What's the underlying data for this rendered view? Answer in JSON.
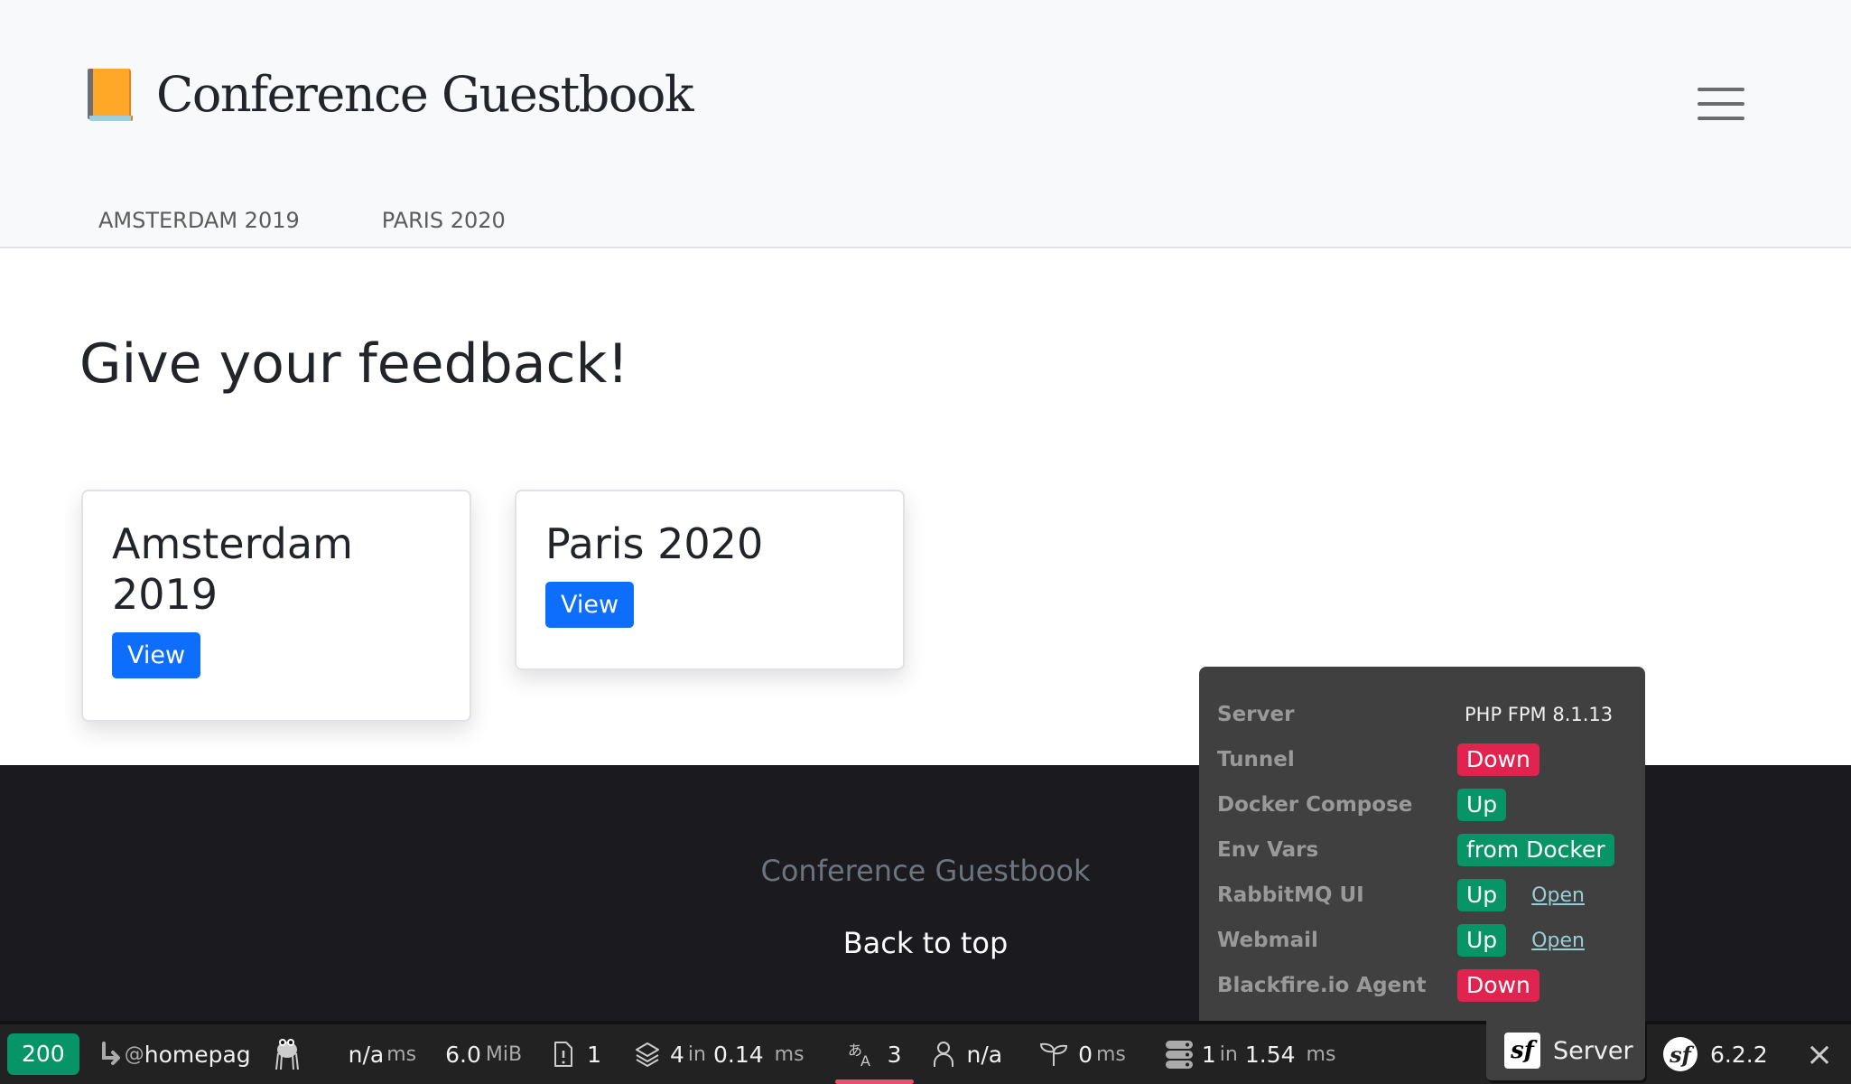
{
  "header": {
    "brand_icon": "book-icon",
    "title": "Conference Guestbook",
    "menu_icon": "hamburger-menu-icon",
    "nav": [
      {
        "label": "AMSTERDAM 2019"
      },
      {
        "label": "PARIS 2020"
      }
    ]
  },
  "main": {
    "heading": "Give your feedback!",
    "cards": [
      {
        "title_line1": "Amsterdam",
        "title_line2": "2019",
        "button": "View"
      },
      {
        "title": "Paris 2020",
        "button": "View"
      }
    ]
  },
  "footer": {
    "title": "Conference Guestbook",
    "back_to_top": "Back to top"
  },
  "server_panel": {
    "rows": [
      {
        "label": "Server",
        "value": "PHP FPM 8.1.13"
      },
      {
        "label": "Tunnel",
        "status": "Down",
        "color": "#e0244f"
      },
      {
        "label": "Docker Compose",
        "status": "Up",
        "color": "#079467"
      },
      {
        "label": "Env Vars",
        "status": "from Docker",
        "color": "#079467"
      },
      {
        "label": "RabbitMQ UI",
        "status": "Up",
        "color": "#079467",
        "link": "Open"
      },
      {
        "label": "Webmail",
        "status": "Up",
        "color": "#079467",
        "link": "Open"
      },
      {
        "label": "Blackfire.io Agent",
        "status": "Down",
        "color": "#e0244f"
      }
    ]
  },
  "toolbar": {
    "status_code": "200",
    "route_prefix": "@",
    "route": "homepag",
    "time_value": "n/a",
    "time_unit": "ms",
    "memory_value": "6.0",
    "memory_unit": "MiB",
    "logs_count": "1",
    "cache_count": "4",
    "cache_in": "in",
    "cache_time": "0.14",
    "cache_unit": "ms",
    "translation_count": "3",
    "user": "n/a",
    "twig_time": "0",
    "twig_unit": "ms",
    "db_count": "1",
    "db_in": "in",
    "db_time": "1.54",
    "db_unit": "ms",
    "server_label": "Server",
    "symfony_version": "6.2.2",
    "close": "×"
  }
}
